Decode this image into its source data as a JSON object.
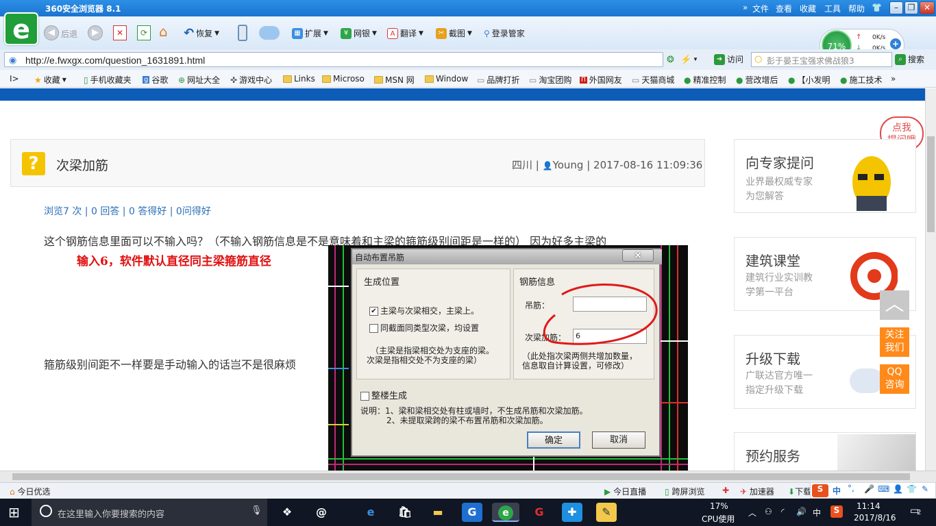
{
  "browser": {
    "title": "360安全浏览器 8.1",
    "menu": [
      "文件",
      "查看",
      "收藏",
      "工具",
      "帮助"
    ],
    "nav": {
      "back_label": "后退",
      "restore_label": "恢复"
    },
    "toolbar_items": [
      "扩展",
      "网银",
      "翻译",
      "截图",
      "登录管家"
    ],
    "speed": {
      "percent": "71%",
      "up": "0K/s",
      "down": "0K/s"
    },
    "url": "http://e.fwxgx.com/question_1631891.html",
    "visit_label": "访问",
    "search_placeholder": "彭于晏王宝强求佛战狼3",
    "search_label": "搜索",
    "bookmarks": [
      "收藏",
      "手机收藏夹",
      "谷歌",
      "网址大全",
      "游戏中心",
      "Links",
      "Microso",
      "MSN 网",
      "Window",
      "品牌打折",
      "淘宝团购",
      "外国网友",
      "天猫商城",
      "精准控制",
      "营改增后",
      "【小发明",
      "施工技术"
    ]
  },
  "question": {
    "title": "次梁加筋",
    "meta": "四川 | ",
    "author": "Young",
    "datetime": " | 2017-08-16 11:09:36",
    "stats": "浏览7 次 | 0 回答 | 0 答得好 | 0问得好",
    "body_line1": "这个钢筋信息里面可以不输入吗？（不输入钢筋信息是不是意味着和主梁的箍筋级别间距是一样的）  因为好多主梁的",
    "red_note": "输入6，软件默认直径同主梁箍筋直径",
    "body_line2": "箍筋级别间距不一样要是手动输入的话岂不是很麻烦"
  },
  "dialog": {
    "title": "自动布置吊筋",
    "close_glyph": "×",
    "group1_title": "生成位置",
    "opt1": "主梁与次梁相交，主梁上。",
    "opt1_checked": true,
    "opt2": "同截面同类型次梁，均设置",
    "note1_line1": "（主梁是指梁相交处为支座的梁。",
    "note1_line2": "次梁是指相交处不为支座的梁）",
    "group2_title": "钢筋信息",
    "hanger_label": "吊筋：",
    "hanger_value": "",
    "secondary_label": "次梁加筋：",
    "secondary_value": "6",
    "note2_line1": "（此处指次梁两侧共增加数量，",
    "note2_line2": "信息取自计算设置，可修改）",
    "whole_floor": "整楼生成",
    "explain_line1": "说明：1、梁和梁相交处有柱或墙时，不生成吊筋和次梁加筋。",
    "explain_line2": "2、未提取梁跨的梁不布置吊筋和次梁加筋。",
    "ok": "确定",
    "cancel": "取消"
  },
  "sidebar": {
    "bubble": "点我\n提问哦",
    "cards": [
      {
        "title": "向专家提问",
        "sub1": "业界最权威专家",
        "sub2": "为您解答"
      },
      {
        "title": "建筑课堂",
        "sub1": "建筑行业实训教",
        "sub2": "学第一平台"
      },
      {
        "title": "升级下载",
        "sub1": "广联达官方唯一",
        "sub2": "指定升级下载"
      },
      {
        "title": "预约服务",
        "sub1": "",
        "sub2": ""
      }
    ],
    "float_follow": "关注\n我们",
    "float_qq": "QQ\n咨询"
  },
  "statusbar": {
    "left": "今日优选",
    "items": [
      "今日直播",
      "跨屏浏览",
      "加速器",
      "下载"
    ],
    "ime": "中"
  },
  "taskbar": {
    "search_placeholder": "在这里输入你要搜索的内容",
    "cpu_percent": "17%",
    "cpu_label": "CPU使用",
    "ime": "中",
    "time": "11:14",
    "date": "2017/8/16",
    "notifications": "2"
  },
  "colors": {
    "title_blue": "#1a74cf",
    "accent_orange": "#ff8a1a",
    "note_red": "#e01010",
    "link_blue": "#2a6fb8"
  }
}
